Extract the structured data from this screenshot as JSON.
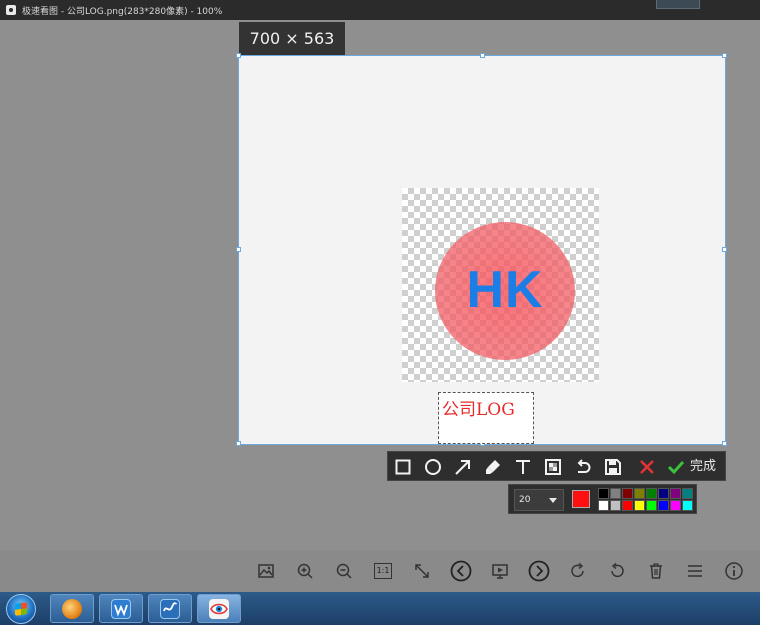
{
  "window": {
    "title": "极速看图 - 公司LOG.png(283*280像素) - 100%"
  },
  "selection": {
    "size_label": "700 × 563"
  },
  "canvas": {
    "logo_text": "HK",
    "text_annotation": "公司LOG"
  },
  "edit_toolbar": {
    "tools": [
      "rectangle-icon",
      "ellipse-icon",
      "arrow-icon",
      "marker-icon",
      "text-icon",
      "mosaic-icon",
      "undo-icon",
      "save-icon",
      "cancel-icon",
      "confirm-icon"
    ],
    "done_label": "完成"
  },
  "properties": {
    "font_size": "20",
    "current_color": "#ff1010",
    "palette": [
      "#000000",
      "#808080",
      "#800000",
      "#808000",
      "#008000",
      "#000080",
      "#800080",
      "#008080",
      "#ffffff",
      "#c0c0c0",
      "#ff0000",
      "#ffff00",
      "#00ff00",
      "#0000ff",
      "#ff00ff",
      "#00ffff"
    ]
  },
  "bottom_toolbar": {
    "buttons": [
      "image-icon",
      "zoom-in-icon",
      "zoom-out-icon",
      "actual-size-icon",
      "fit-window-icon",
      "previous-icon",
      "slideshow-icon",
      "next-icon",
      "rotate-right-icon",
      "rotate-left-icon",
      "delete-icon",
      "menu-icon",
      "info-icon"
    ],
    "actual_size_label": "1:1"
  },
  "taskbar": {
    "apps": [
      "start-orb",
      "browser-icon",
      "wps-writer-icon",
      "app-icon",
      "image-viewer-icon"
    ]
  }
}
